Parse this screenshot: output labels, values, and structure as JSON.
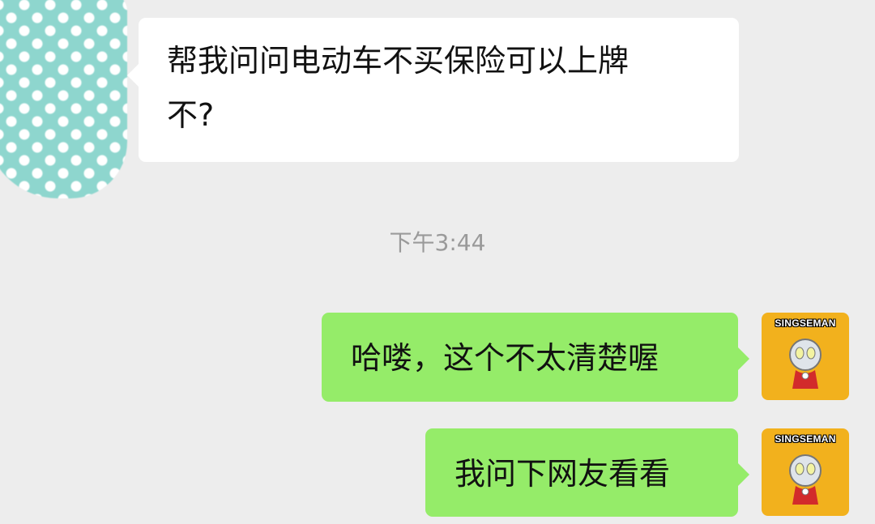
{
  "chat": {
    "messages": [
      {
        "side": "left",
        "text": "帮我问问电动车不买保险可以上牌\n不?"
      },
      {
        "timestamp": "下午3:44"
      },
      {
        "side": "right",
        "text": "哈喽，这个不太清楚喔"
      },
      {
        "side": "right",
        "text": "我问下网友看看"
      }
    ],
    "avatar_right_brand": "SINGSEMAN"
  },
  "colors": {
    "background": "#ededed",
    "incoming_bubble": "#ffffff",
    "outgoing_bubble": "#95ec69",
    "timestamp_text": "#9a9a9a"
  }
}
